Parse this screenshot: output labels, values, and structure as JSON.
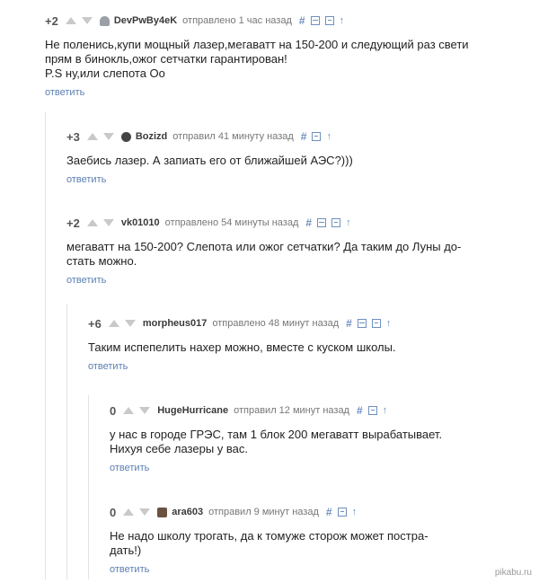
{
  "reply_label": "ответить",
  "comments": [
    {
      "rating": "+2",
      "author": "DevPwBy4eK",
      "time": "отправлено 1 час назад",
      "lines": [
        "Не поленись,купи мощный лазер,мегаватт на 150-200 и следующий раз свети",
        "прям в бинокль,ожог сетчатки гарантирован!",
        "P.S ну,или слепота Оо"
      ]
    },
    {
      "rating": "+3",
      "author": "Bozizd",
      "time": "отправил 41 минуту назад",
      "lines": [
        "Заебись лазер. А запиать его от ближайшей АЭС?)))"
      ]
    },
    {
      "rating": "+2",
      "author": "vk01010",
      "time": "отправлено 54 минуты назад",
      "lines": [
        "мегаватт на 150-200? Слепота или ожог сетчатки? Да таким до Луны до-",
        "стать можно."
      ]
    },
    {
      "rating": "+6",
      "author": "morpheus017",
      "time": "отправлено 48 минут назад",
      "lines": [
        "Таким испепелить нахер можно, вместе с куском школы."
      ]
    },
    {
      "rating": "0",
      "author": "HugeHurricane",
      "time": "отправил 12 минут назад",
      "lines": [
        "у нас в городе ГРЭС, там 1 блок 200 мегаватт вырабатывает.",
        "Нихуя себе лазеры у вас."
      ]
    },
    {
      "rating": "0",
      "author": "ara603",
      "time": "отправил 9 минут назад",
      "lines": [
        "Не надо школу трогать, да к томуже сторож может постра-",
        "дать!)"
      ]
    }
  ],
  "watermark": "pikabu.ru"
}
